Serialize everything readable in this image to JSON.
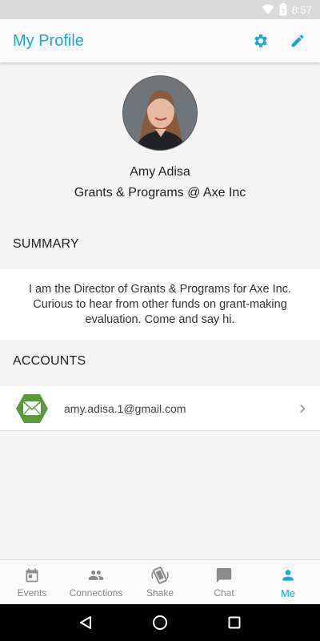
{
  "status_bar": {
    "time": "8:57"
  },
  "app_bar": {
    "title": "My Profile",
    "settings_icon": "gear-icon",
    "edit_icon": "pencil-icon"
  },
  "profile": {
    "name": "Amy Adisa",
    "tagline": "Grants & Programs @ Axe Inc"
  },
  "summary": {
    "header": "SUMMARY",
    "text": "I am the Director of Grants & Programs for Axe Inc. Curious to hear from other funds on grant-making evaluation. Come and say hi."
  },
  "accounts": {
    "header": "ACCOUNTS",
    "items": [
      {
        "icon": "mail-icon",
        "email": "amy.adisa.1@gmail.com"
      }
    ]
  },
  "bottom_nav": {
    "items": [
      {
        "label": "Events",
        "icon": "calendar-icon"
      },
      {
        "label": "Connections",
        "icon": "people-icon"
      },
      {
        "label": "Shake",
        "icon": "shake-phone-icon"
      },
      {
        "label": "Chat",
        "icon": "chat-icon"
      },
      {
        "label": "Me",
        "icon": "person-icon",
        "active": true
      }
    ]
  },
  "colors": {
    "accent": "#1fa6cf",
    "mail_badge": "#5a9a3c"
  }
}
